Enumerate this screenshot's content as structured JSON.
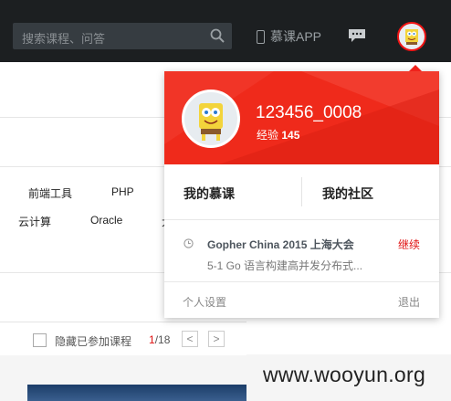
{
  "header": {
    "search_placeholder": "搜索课程、问答",
    "app_label": "慕课APP"
  },
  "categories": {
    "row1": [
      "前端工具",
      "PHP"
    ],
    "row2": [
      "云计算",
      "Oracle",
      "大"
    ]
  },
  "filter": {
    "hide_joined_label": "隐藏已参加课程",
    "page_current": "1",
    "page_total": "/18",
    "prev": "<",
    "next": ">"
  },
  "watermark": "www.wooyun.org",
  "dropdown": {
    "username": "123456_0008",
    "exp_label": "经验",
    "exp_value": "145",
    "tab_my_courses": "我的慕课",
    "tab_my_community": "我的社区",
    "recent_course": "Gopher China 2015 上海大会",
    "continue_label": "继续",
    "recent_lesson": "5-1 Go 语言构建高并发分布式...",
    "settings_label": "个人设置",
    "logout_label": "退出"
  },
  "colors": {
    "accent": "#ef2a1b",
    "topbar": "#1c1f21"
  }
}
